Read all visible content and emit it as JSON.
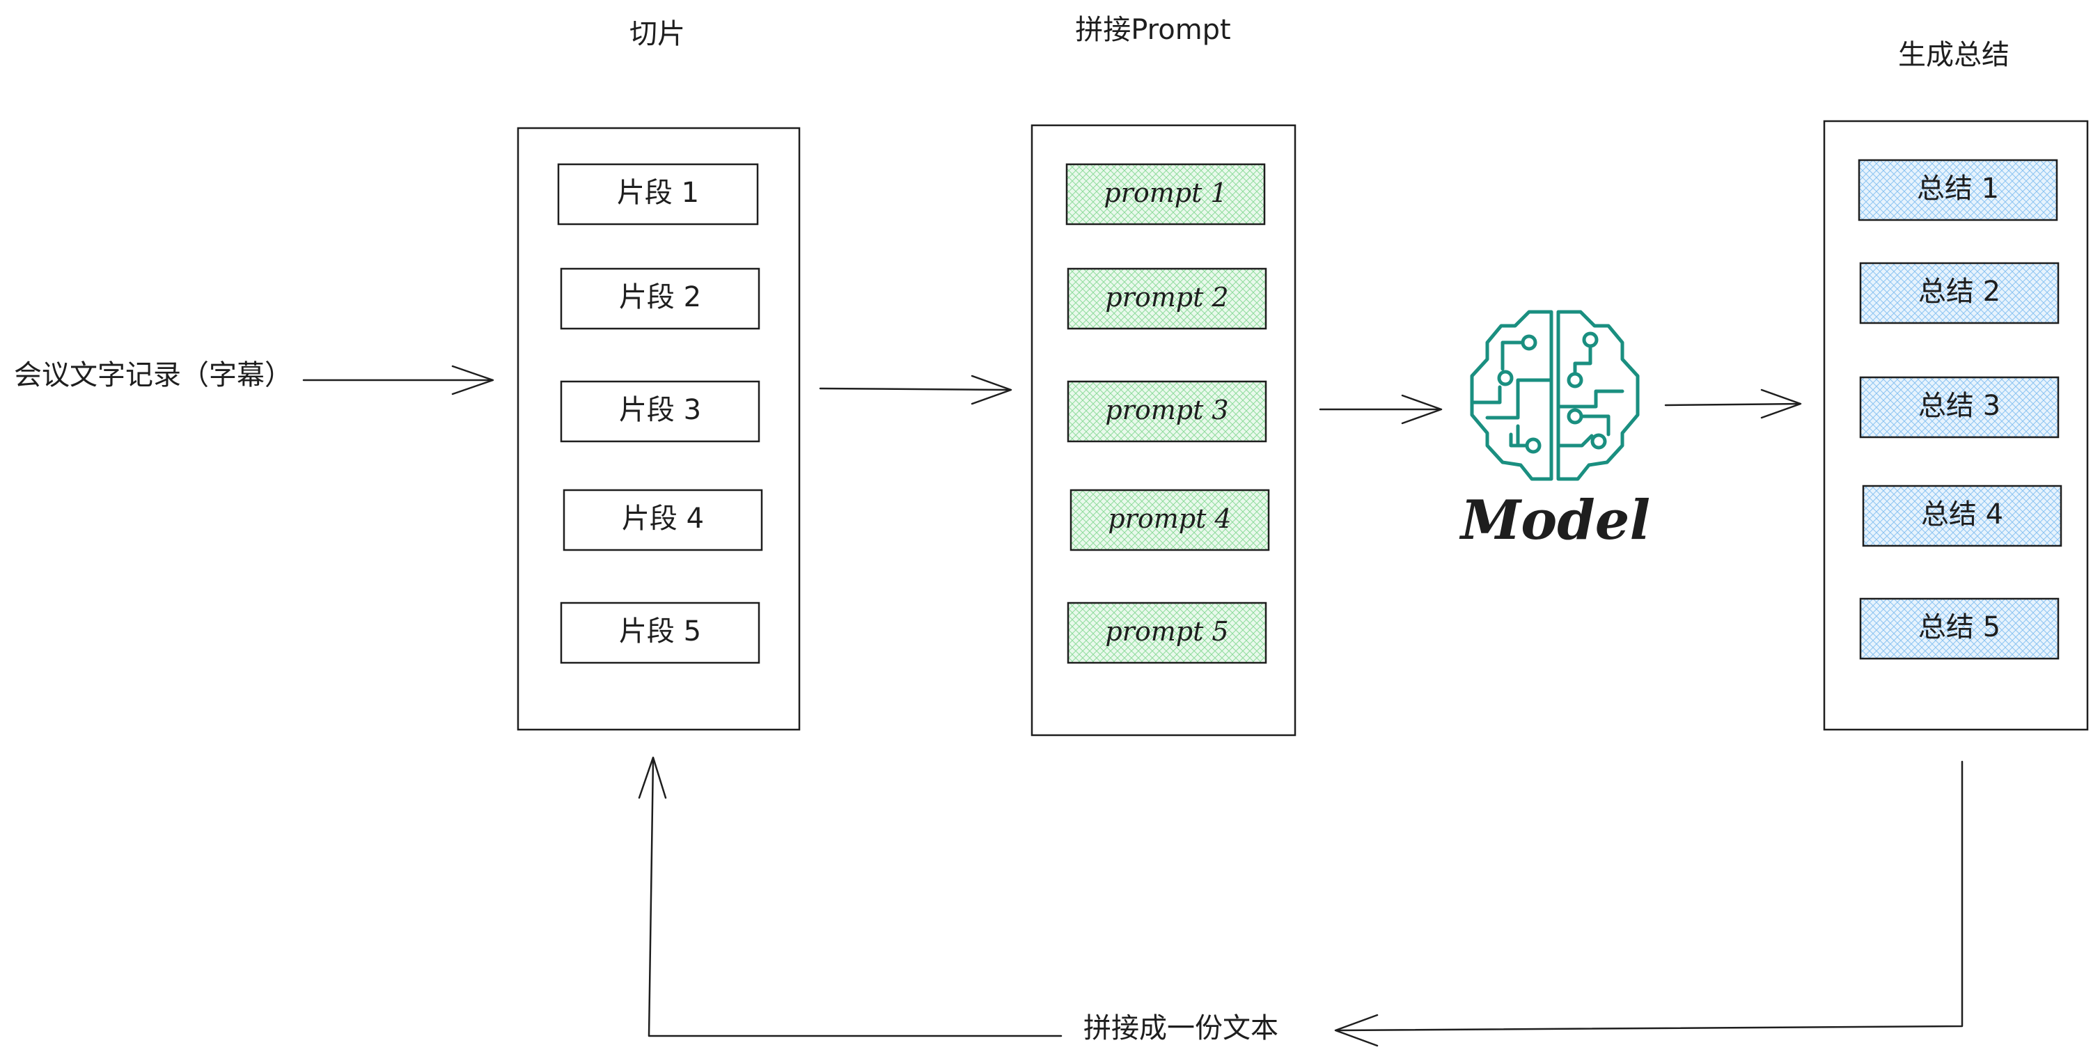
{
  "titles": {
    "slicing": "切片",
    "prompt_assembly": "拼接Prompt",
    "generate_summary": "生成总结"
  },
  "input_label": "会议文字记录（字幕）",
  "chunks": [
    "片段 1",
    "片段 2",
    "片段 3",
    "片段 4",
    "片段 5"
  ],
  "prompts": [
    "prompt 1",
    "prompt 2",
    "prompt 3",
    "prompt 4",
    "prompt 5"
  ],
  "summaries": [
    "总结 1",
    "总结 2",
    "总结 3",
    "总结 4",
    "总结 5"
  ],
  "model": {
    "label": "Model",
    "icon": "brain-circuit-icon"
  },
  "loop_label": "拼接成一份文本",
  "colors": {
    "stroke": "#1e1e1e",
    "prompt_fill": "#b2f2bb",
    "summary_fill": "#a5d8ff",
    "brain": "#1a8f80"
  }
}
